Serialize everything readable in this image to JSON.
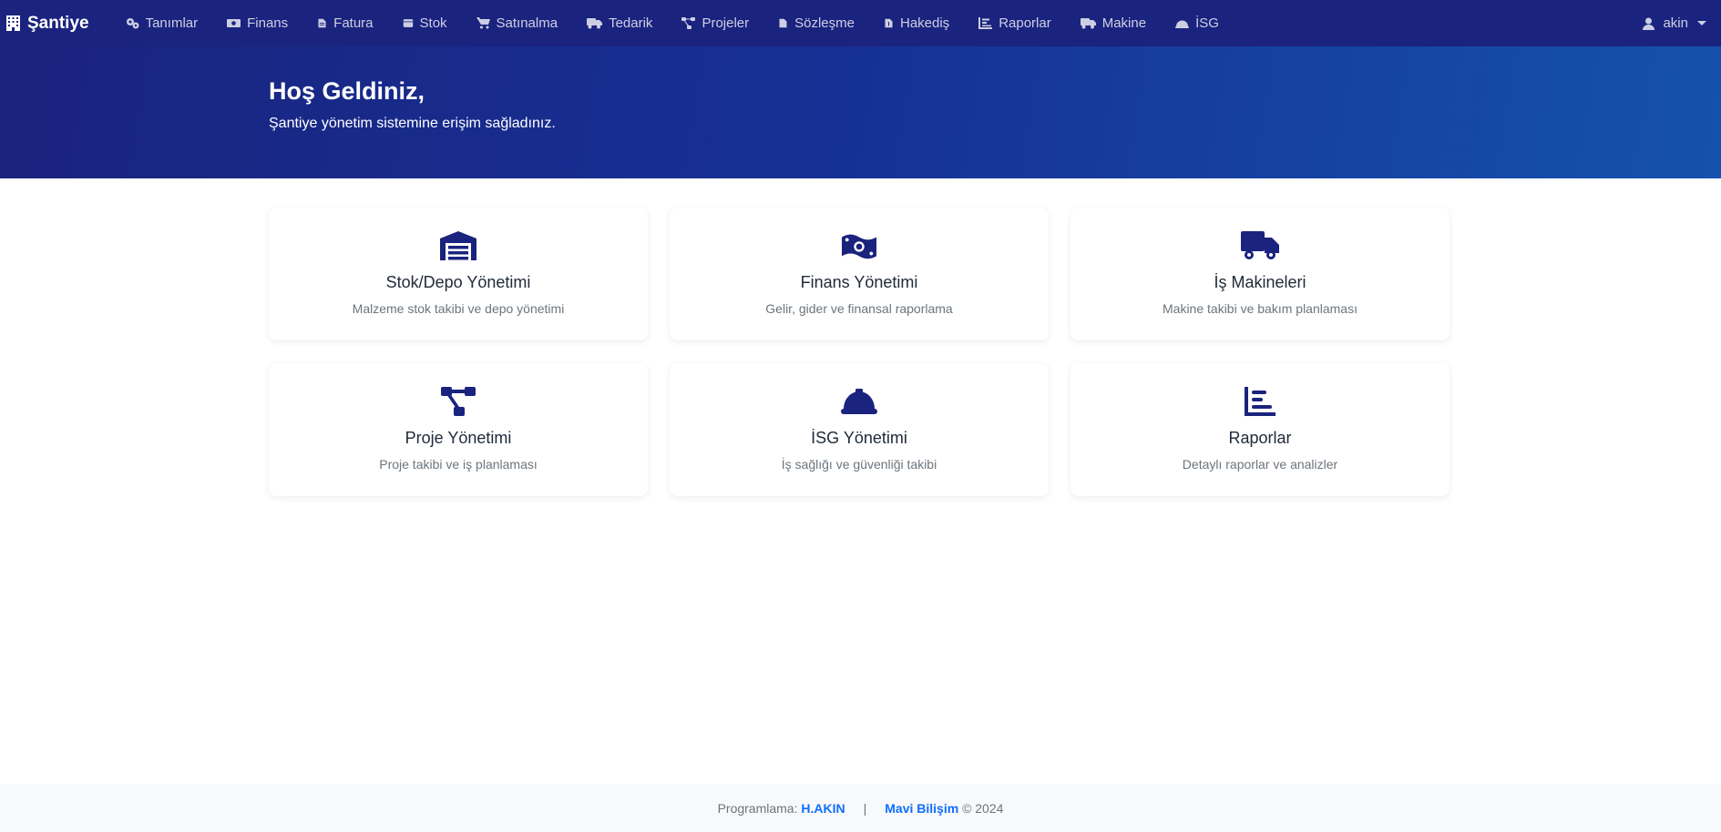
{
  "brand": {
    "label": "Şantiye",
    "icon": "building-icon"
  },
  "nav": {
    "items": [
      {
        "label": "Tanımlar",
        "icon": "gears-icon"
      },
      {
        "label": "Finans",
        "icon": "money-bill-icon"
      },
      {
        "label": "Fatura",
        "icon": "file-invoice-icon"
      },
      {
        "label": "Stok",
        "icon": "box-icon"
      },
      {
        "label": "Satınalma",
        "icon": "shopping-cart-icon"
      },
      {
        "label": "Tedarik",
        "icon": "truck-icon"
      },
      {
        "label": "Projeler",
        "icon": "project-diagram-icon"
      },
      {
        "label": "Sözleşme",
        "icon": "file-contract-icon"
      },
      {
        "label": "Hakediş",
        "icon": "file-dollar-icon"
      },
      {
        "label": "Raporlar",
        "icon": "chart-bar-icon"
      },
      {
        "label": "Makine",
        "icon": "truck-icon"
      },
      {
        "label": "İSG",
        "icon": "hard-hat-icon"
      }
    ],
    "user": {
      "label": "akin",
      "icon": "user-icon"
    }
  },
  "hero": {
    "title": "Hoş Geldiniz,",
    "subtitle": "Şantiye yönetim sistemine erişim sağladınız."
  },
  "cards": [
    {
      "title": "Stok/Depo Yönetimi",
      "desc": "Malzeme stok takibi ve depo yönetimi",
      "icon": "warehouse-icon"
    },
    {
      "title": "Finans Yönetimi",
      "desc": "Gelir, gider ve finansal raporlama",
      "icon": "money-bill-wave-icon"
    },
    {
      "title": "İş Makineleri",
      "desc": "Makine takibi ve bakım planlaması",
      "icon": "truck-icon"
    },
    {
      "title": "Proje Yönetimi",
      "desc": "Proje takibi ve iş planlaması",
      "icon": "project-diagram-icon"
    },
    {
      "title": "İSG Yönetimi",
      "desc": "İş sağlığı ve güvenliği takibi",
      "icon": "hard-hat-icon"
    },
    {
      "title": "Raporlar",
      "desc": "Detaylı raporlar ve analizler",
      "icon": "chart-bar-icon"
    }
  ],
  "footer": {
    "prefix": "Programlama:",
    "author": "H.AKIN",
    "separator": "|",
    "company": "Mavi Bilişim",
    "suffix": "© 2024"
  },
  "colors": {
    "navbar": "#1a237e",
    "accent": "#1a237e",
    "link": "#0d6efd"
  }
}
